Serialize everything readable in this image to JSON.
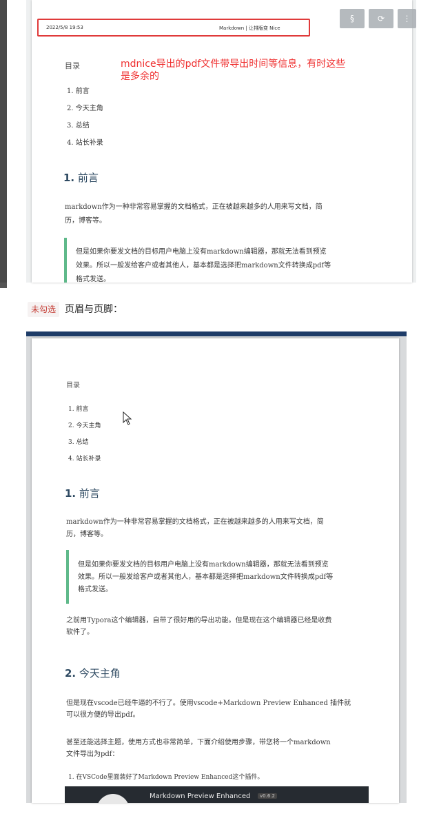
{
  "toolbar": {
    "buttons": [
      {
        "name": "section-button",
        "glyph": "§"
      },
      {
        "name": "refresh-button",
        "glyph": "⟳"
      },
      {
        "name": "menu-button",
        "glyph": "⋮"
      }
    ]
  },
  "preview_top": {
    "header_datetime": "2022/5/8 19:53",
    "header_title": "Markdown | 让排版变 Nice",
    "note": "mdnice导出的pdf文件带导出时间等信息，有时这些是多余的",
    "toc_title": "目录",
    "toc": [
      "1. 前言",
      "2. 今天主角",
      "3. 总结",
      "4. 站长补录"
    ],
    "heading_num": "1.",
    "heading_text": "前言",
    "para1_line1": "markdown作为一种非常容易掌握的文档格式，正在被越来越多的人用来写文档，简",
    "para1_line2": "历，博客等。",
    "quote_line1": "但是如果你要发文档的目标用户电脑上没有markdown编辑器，那就无法看到预览",
    "quote_line2": "效果。所以一般发给客户或者其他人，基本都是选择把markdown文件转换成pdf等",
    "quote_line3": "格式发送。"
  },
  "caption": {
    "badge": "未勾选",
    "text": "页眉与页脚："
  },
  "preview_bottom": {
    "toc_title": "目录",
    "toc": [
      "1. 前言",
      "2. 今天主角",
      "3. 总结",
      "4. 站长补录"
    ],
    "h1_num": "1.",
    "h1_text": "前言",
    "para1_line1": "markdown作为一种非常容易掌握的文档格式，正在被越来越多的人用来写文档，简",
    "para1_line2": "历，博客等。",
    "quote_line1": "但是如果你要发文档的目标用户电脑上没有markdown编辑器，那就无法看到预览",
    "quote_line2": "效果。所以一般发给客户或者其他人，基本都是选择把markdown文件转换成pdf等",
    "quote_line3": "格式发送。",
    "para2_line1": "之前用Typora这个编辑器，自带了很好用的导出功能。但是现在这个编辑器已经是收费",
    "para2_line2": "软件了。",
    "h2_num": "2.",
    "h2_text": "今天主角",
    "para3_line1": "但是现在vscode已经牛逼的不行了。使用vscode+Markdown Preview Enhanced 插件就",
    "para3_line2": "可以很方便的导出pdf。",
    "para4_line1": "甚至还能选择主题，使用方式也非常简单，下面介绍使用步骤，带您将一个markdown",
    "para4_line2": "文件导出为pdf：",
    "step1": "1. 在VSCode里面装好了Markdown Preview Enhanced这个插件。",
    "ext_title": "Markdown Preview Enhanced",
    "ext_version": "v0.6.2"
  }
}
